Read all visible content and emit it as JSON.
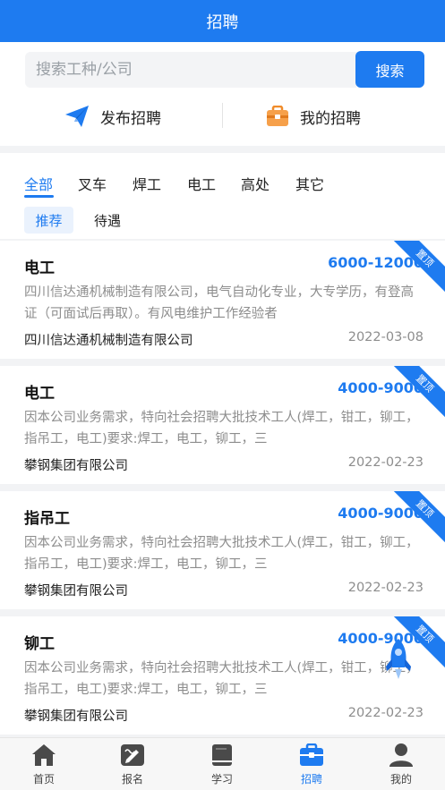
{
  "header": {
    "title": "招聘"
  },
  "search": {
    "placeholder": "搜索工种/公司",
    "button_label": "搜索"
  },
  "actions": {
    "post_label": "发布招聘",
    "mine_label": "我的招聘"
  },
  "categories": [
    {
      "label": "全部",
      "active": true
    },
    {
      "label": "叉车",
      "active": false
    },
    {
      "label": "焊工",
      "active": false
    },
    {
      "label": "电工",
      "active": false
    },
    {
      "label": "高处",
      "active": false
    },
    {
      "label": "其它",
      "active": false
    }
  ],
  "sort_tabs": [
    {
      "label": "推荐",
      "active": true
    },
    {
      "label": "待遇",
      "active": false
    }
  ],
  "jobs": [
    {
      "title": "电工",
      "salary": "6000-12000",
      "description": "四川信达通机械制造有限公司，电气自动化专业，大专学历，有登高证（可面试后再取）。有风电维护工作经验者",
      "company": "四川信达通机械制造有限公司",
      "date": "2022-03-08",
      "badge": "置顶"
    },
    {
      "title": "电工",
      "salary": "4000-9000",
      "description": "因本公司业务需求，特向社会招聘大批技术工人(焊工，钳工，铆工，指吊工，电工)要求:焊工，电工，铆工，三",
      "company": "攀钢集团有限公司",
      "date": "2022-02-23",
      "badge": "置顶"
    },
    {
      "title": "指吊工",
      "salary": "4000-9000",
      "description": "因本公司业务需求，特向社会招聘大批技术工人(焊工，钳工，铆工，指吊工，电工)要求:焊工，电工，铆工，三",
      "company": "攀钢集团有限公司",
      "date": "2022-02-23",
      "badge": "置顶"
    },
    {
      "title": "铆工",
      "salary": "4000-9000",
      "description": "因本公司业务需求，特向社会招聘大批技术工人(焊工，钳工，铆工，指吊工，电工)要求:焊工，电工，铆工，三",
      "company": "攀钢集团有限公司",
      "date": "2022-02-23",
      "badge": "置顶"
    }
  ],
  "tabbar": [
    {
      "label": "首页",
      "icon": "home-icon",
      "active": false
    },
    {
      "label": "报名",
      "icon": "signup-icon",
      "active": false
    },
    {
      "label": "学习",
      "icon": "book-icon",
      "active": false
    },
    {
      "label": "招聘",
      "icon": "briefcase-icon",
      "active": true
    },
    {
      "label": "我的",
      "icon": "user-icon",
      "active": false
    }
  ],
  "colors": {
    "primary": "#1e7bf0",
    "muted_text": "#8d8d8d",
    "background": "#f2f3f5"
  }
}
